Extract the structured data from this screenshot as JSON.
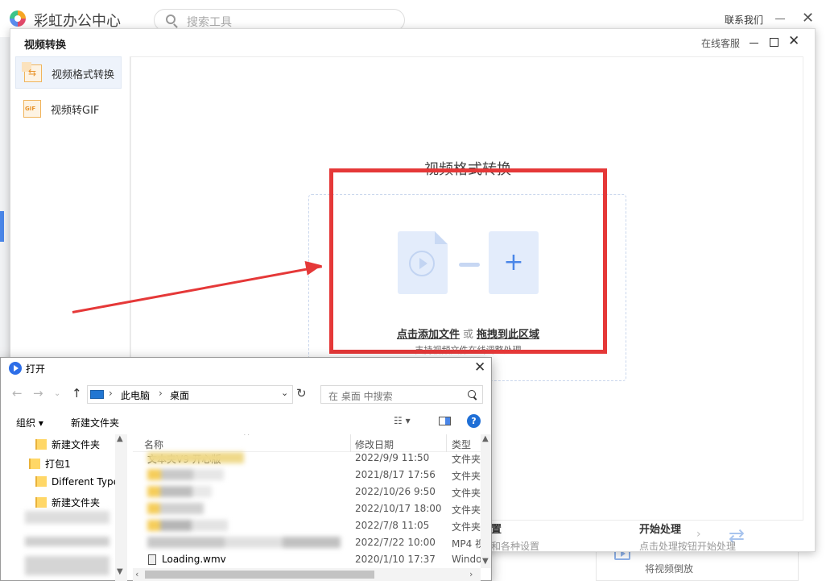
{
  "app": {
    "title": "彩虹办公中心",
    "search_placeholder": "搜索工具",
    "contact": "联系我们",
    "bottom_card_label": "将视频倒放"
  },
  "video_window": {
    "title": "视频转换",
    "online_service": "在线客服",
    "sidebar": [
      {
        "label": "视频格式转换",
        "icon": "convert-icon",
        "active": true
      },
      {
        "label": "视频转GIF",
        "icon": "gif-icon",
        "active": false
      }
    ],
    "heading": "视频格式转换",
    "drop": {
      "add_link": "点击添加文件",
      "or": "或",
      "drag_link": "拖拽到此区域",
      "hint": "支持视频文件在线调整处理"
    },
    "steps": [
      {
        "title": "置",
        "subtitle": "和各种设置"
      },
      {
        "title": "开始处理",
        "subtitle": "点击处理按钮开始处理"
      }
    ],
    "annotation_color": "#e53838"
  },
  "dialog": {
    "title": "打开",
    "path": [
      "此电脑",
      "桌面"
    ],
    "search_placeholder": "在 桌面 中搜索",
    "toolbar": {
      "organize": "组织 ▾",
      "new_folder": "新建文件夹"
    },
    "tree": [
      {
        "label": "新建文件夹",
        "indent": 1
      },
      {
        "label": "打包1",
        "indent": 0
      },
      {
        "label": "Different Type",
        "indent": 1
      },
      {
        "label": "新建文件夹",
        "indent": 1
      }
    ],
    "columns": {
      "name": "名称",
      "date": "修改日期",
      "type": "类型"
    },
    "rows": [
      {
        "name": "文本夹V9 开心版",
        "date": "2022/9/9 11:50",
        "type": "文件夹",
        "icon": "folder-icon"
      },
      {
        "name": "",
        "date": "2021/8/17 17:56",
        "type": "文件夹",
        "icon": "folder-icon"
      },
      {
        "name": "",
        "date": "2022/10/26 9:50",
        "type": "文件夹",
        "icon": "folder-icon"
      },
      {
        "name": "",
        "date": "2022/10/17 18:00",
        "type": "文件夹",
        "icon": "folder-icon"
      },
      {
        "name": "",
        "date": "2022/7/8 11:05",
        "type": "文件夹",
        "icon": "folder-icon"
      },
      {
        "name": "",
        "date": "2022/7/22 10:00",
        "type": "MP4 视",
        "icon": "video-file-icon"
      },
      {
        "name": "Loading.wmv",
        "date": "2020/1/10 17:37",
        "type": "Windo",
        "icon": "wmv-file-icon"
      }
    ]
  }
}
